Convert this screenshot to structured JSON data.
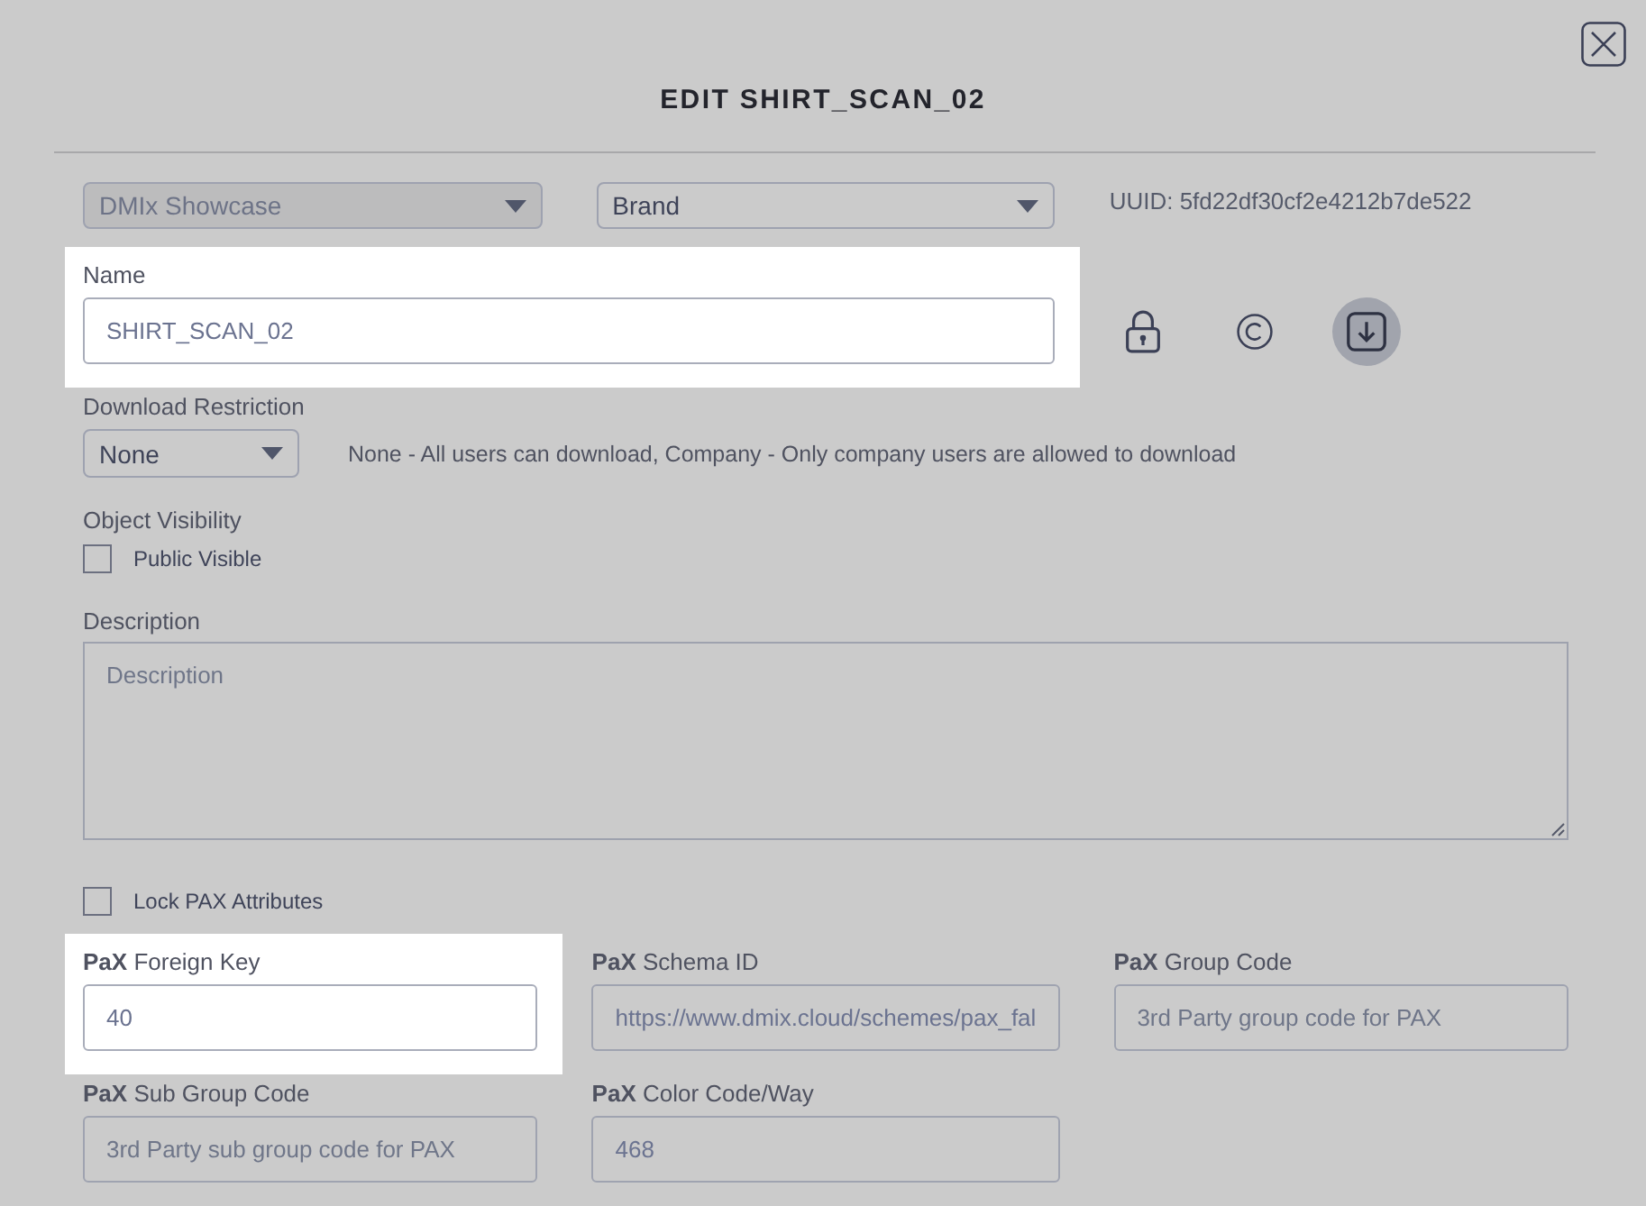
{
  "dialog": {
    "title": "EDIT SHIRT_SCAN_02"
  },
  "top_row": {
    "dropdowns": [
      {
        "value": "DMIx Showcase",
        "disabled": true
      },
      {
        "value": "Brand",
        "disabled": false
      }
    ],
    "uuid": "UUID: 5fd22df30cf2e4212b7de522"
  },
  "name_field": {
    "label": "Name",
    "value": "SHIRT_SCAN_02",
    "highlighted": true
  },
  "asset_toggles": [
    {
      "kind": "lock",
      "selected": false
    },
    {
      "kind": "copyright",
      "selected": false
    },
    {
      "kind": "download",
      "selected": true
    }
  ],
  "download_restriction": {
    "label": "Download Restriction",
    "value": "None",
    "hint": "None - All users can download, Company - Only company users are allowed to download"
  },
  "object_visibility": {
    "label": "Object Visibility",
    "checkbox": {
      "label": "Public Visible",
      "checked": false
    }
  },
  "description": {
    "label": "Description",
    "placeholder": "Description"
  },
  "lock_pax": {
    "label": "Lock PAX Attributes",
    "checked": false
  },
  "pax_fields": [
    {
      "label": "**PaX** Foreign Key",
      "value": "40",
      "highlighted": true
    },
    {
      "label": "**PaX** Schema ID",
      "value": "https://www.dmix.cloud/schemes/pax_fal",
      "highlighted": false
    },
    {
      "label": "**PaX** Group Code",
      "placeholder": "3rd Party group code for PAX",
      "highlighted": false
    },
    {
      "label": "**PaX** Sub Group Code",
      "placeholder": "3rd Party sub group code for PAX",
      "highlighted": false
    },
    {
      "label": "**PaX** Color Code/Way",
      "value": "468",
      "highlighted": false
    }
  ]
}
